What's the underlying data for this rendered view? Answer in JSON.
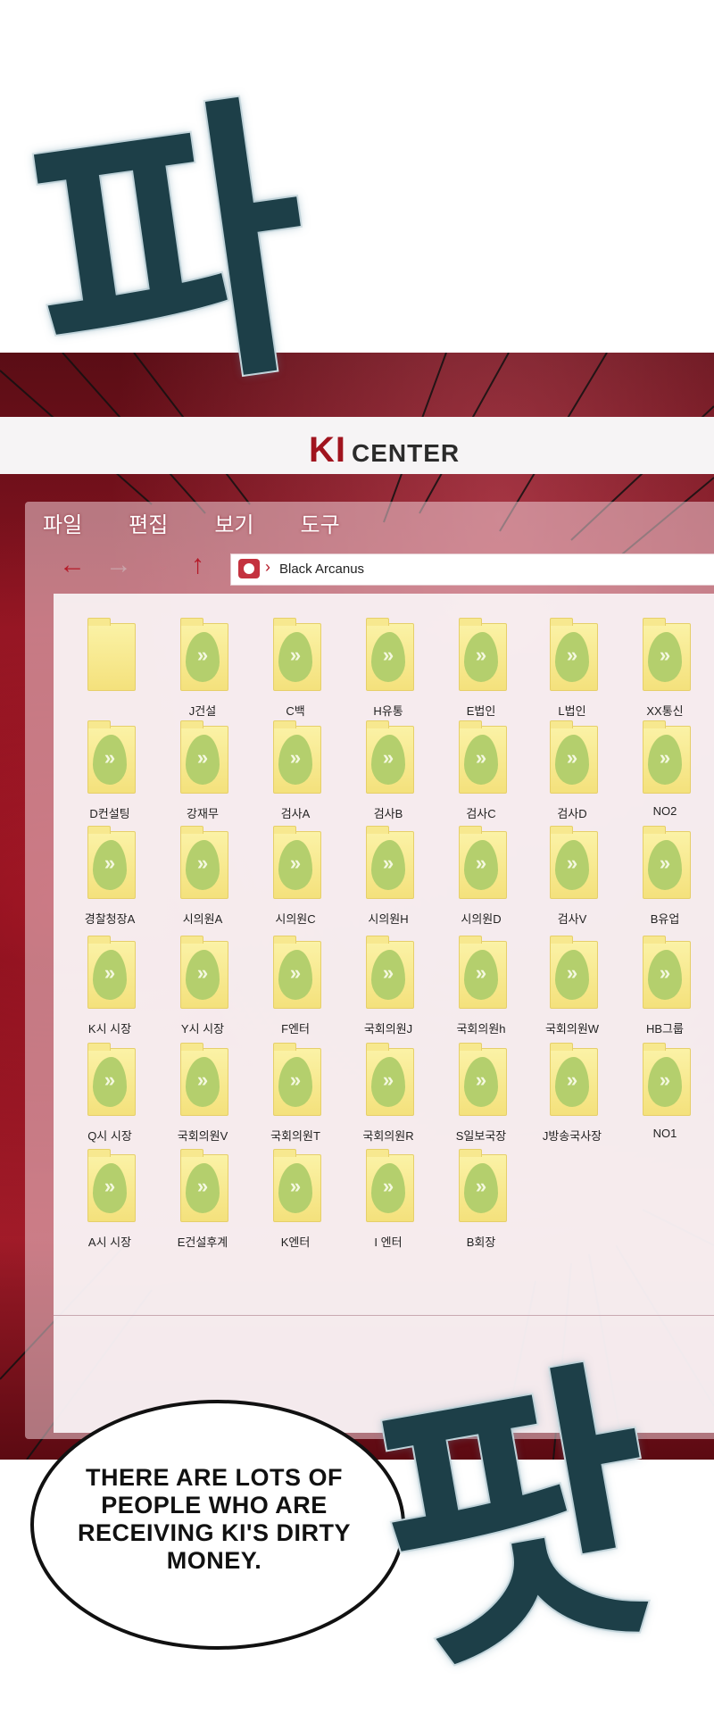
{
  "sound_effect": {
    "top": "파",
    "bottom": "팟"
  },
  "window_title": {
    "ki": "KI",
    "center": "CENTER"
  },
  "menu": [
    "파일",
    "편집",
    "보기",
    "도구"
  ],
  "toolbar": {
    "back_icon": "←",
    "forward_icon": "→",
    "down_icon": "⌄",
    "up_icon": "↑"
  },
  "address_bar": {
    "path": "Black Arcanus",
    "icon": "folder-users-icon",
    "separator": "›"
  },
  "items": [
    {
      "label": ""
    },
    {
      "label": "J건설"
    },
    {
      "label": "C백"
    },
    {
      "label": "H유통"
    },
    {
      "label": "E법인"
    },
    {
      "label": "L법인"
    },
    {
      "label": "XX통신"
    },
    {
      "label": "D컨설팅"
    },
    {
      "label": "강재무"
    },
    {
      "label": "검사A"
    },
    {
      "label": "검사B"
    },
    {
      "label": "검사C"
    },
    {
      "label": "검사D"
    },
    {
      "label": "NO2"
    },
    {
      "label": "경찰청장A"
    },
    {
      "label": "시의원A"
    },
    {
      "label": "시의원C"
    },
    {
      "label": "시의원H"
    },
    {
      "label": "시의원D"
    },
    {
      "label": "검사V"
    },
    {
      "label": "B유업"
    },
    {
      "label": "K시 시장"
    },
    {
      "label": "Y시 시장"
    },
    {
      "label": "F엔터"
    },
    {
      "label": "국회의원J"
    },
    {
      "label": "국회의원h"
    },
    {
      "label": "국회의원W"
    },
    {
      "label": "HB그룹"
    },
    {
      "label": "Q시 시장"
    },
    {
      "label": "국회의원V"
    },
    {
      "label": "국회의원T"
    },
    {
      "label": "국회의원R"
    },
    {
      "label": "S일보국장"
    },
    {
      "label": "J방송국사장"
    },
    {
      "label": "NO1"
    },
    {
      "label": "A시 시장"
    },
    {
      "label": "E건설후계"
    },
    {
      "label": "K엔터"
    },
    {
      "label": "I 엔터"
    },
    {
      "label": "B회장"
    }
  ],
  "speech_bubble": "THERE ARE LOTS OF PEOPLE WHO ARE RECEIVING KI'S DIRTY MONEY.",
  "colors": {
    "accent": "#b51a28",
    "background": "#8b1421",
    "folder": "#f4e17c",
    "leaf": "#b4cf6d"
  }
}
